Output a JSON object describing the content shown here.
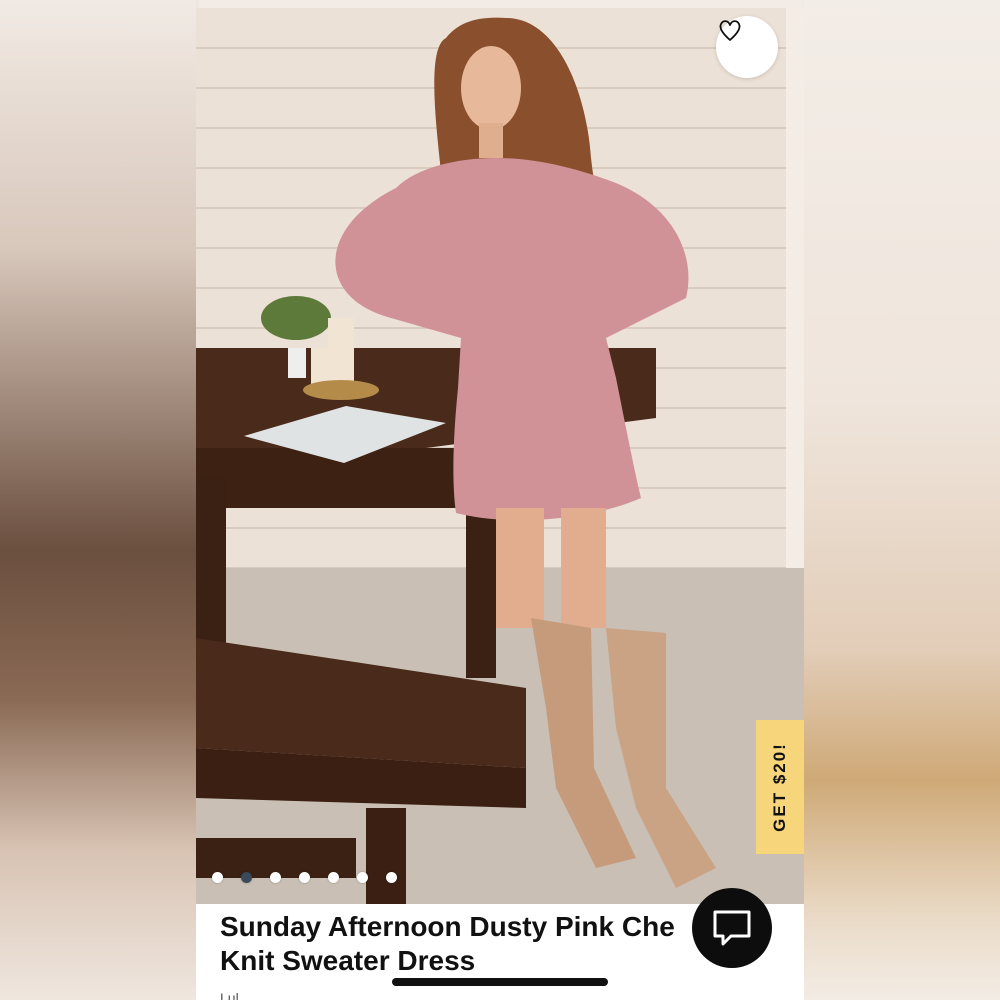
{
  "product": {
    "title_line1": "Sunday Afternoon Dusty Pink Che",
    "title_line2": "Knit Sweater Dress",
    "brand_peek": "Lul"
  },
  "promo": {
    "label": "GET $20!"
  },
  "carousel": {
    "total": 7,
    "active_index": 1
  },
  "icons": {
    "favorite": "heart-icon",
    "chat": "chat-bubble-icon"
  },
  "colors": {
    "promo_bg": "#f7d57a",
    "chat_bg": "#0d0d0d",
    "active_dot": "#3a4a5a"
  }
}
